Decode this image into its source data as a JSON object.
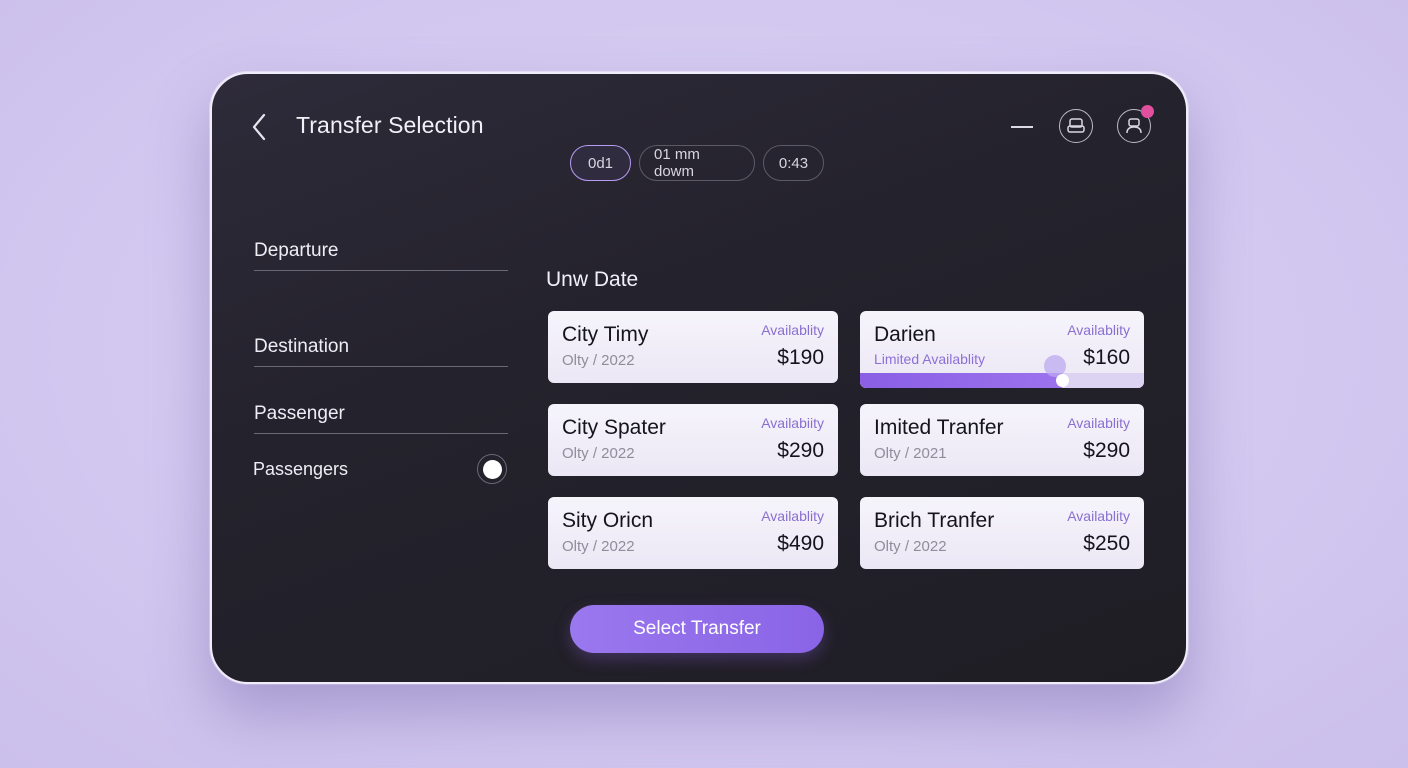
{
  "header": {
    "title": "Transfer Selection",
    "pills": [
      "0d1",
      "01 mm dowm",
      "0:43"
    ],
    "active_pill": 0
  },
  "form": {
    "departure_label": "Departure",
    "destination_label": "Destination",
    "passenger_label": "Passenger",
    "passengers_toggle_label": "Passengers"
  },
  "section": {
    "title": "Unw Date"
  },
  "transfers": [
    {
      "name": "City Timy",
      "sub": "Olty / 2022",
      "availability": "Availablity",
      "price": "$190"
    },
    {
      "name": "Darien",
      "sub": "Limited Availablity",
      "availability": "Availablity",
      "price": "$160",
      "limited": true,
      "availability_level": 0.71
    },
    {
      "name": "City Spater",
      "sub": "Olty / 2022",
      "availability": "Availabiity",
      "price": "$290"
    },
    {
      "name": "Imited Tranfer",
      "sub": "Olty / 2021",
      "availability": "Availablity",
      "price": "$290"
    },
    {
      "name": "Sity Oricn",
      "sub": "Olty / 2022",
      "availability": "Availablity",
      "price": "$490"
    },
    {
      "name": "Brich Tranfer",
      "sub": "Olty / 2022",
      "availability": "Availablity",
      "price": "$250"
    }
  ],
  "actions": {
    "select_label": "Select Transfer"
  },
  "colors": {
    "accent": "#9a78ee",
    "notification": "#e0509c",
    "panel": "#24222c",
    "card": "#f3f0fa"
  },
  "icons": {
    "back": "chevron-left-icon",
    "minimize": "minimize-icon",
    "seat": "seat-icon",
    "profile": "profile-icon"
  }
}
